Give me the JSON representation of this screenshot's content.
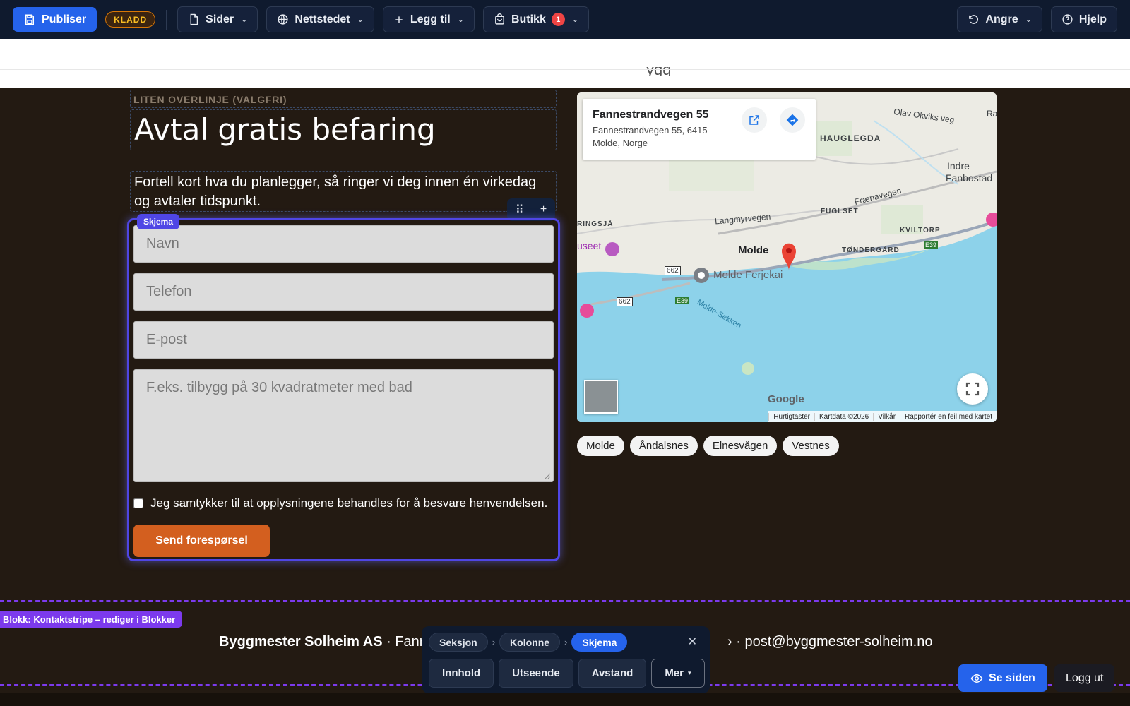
{
  "toolbar": {
    "publish_label": "Publiser",
    "draft_badge": "KLADD",
    "pages_label": "Sider",
    "site_label": "Nettstedet",
    "add_label": "Legg til",
    "shop_label": "Butikk",
    "shop_count": "1",
    "undo_label": "Angre",
    "help_label": "Hjelp"
  },
  "header_ghost": "ygg",
  "section": {
    "eyebrow": "LITEN OVERLINJE (VALGFRI)",
    "heading": "Avtal gratis befaring",
    "intro": "Fortell kort hva du planlegger, så ringer vi deg innen én virkedag og avtaler tidspunkt."
  },
  "block_tools": {
    "drag": "⠿",
    "add": "+"
  },
  "form": {
    "tag": "Skjema",
    "name_placeholder": "Navn",
    "phone_placeholder": "Telefon",
    "email_placeholder": "E-post",
    "message_placeholder": "F.eks. tilbygg på 30 kvadratmeter med bad",
    "consent_label": "Jeg samtykker til at opplysningene behandles for å besvare henvendelsen.",
    "submit_label": "Send forespørsel"
  },
  "map": {
    "place_title": "Fannestrandvegen 55",
    "place_address": "Fannestrandvegen 55, 6415 Molde, Norge",
    "labels": {
      "olav": "Olav Okviks veg",
      "haugl": "HAUGLEGDA",
      "indre": "Indre",
      "fanbostad": "Fanbostad",
      "fraen": "Frænavegen",
      "fuglset": "FUGLSET",
      "kviltorp": "KVILTORP",
      "langmyr": "Langmyrvegen",
      "ringsja": "RINGSJÅ",
      "useet": "useet",
      "molde": "Molde",
      "tonder": "TØNDERGÅRD",
      "ferjekai": "Molde Ferjekai",
      "sekken": "Molde-Sekken",
      "r662a": "662",
      "r662b": "662",
      "e39a": "E39",
      "e39b": "E39",
      "ra": "Ra"
    },
    "google": "Google",
    "attribution": [
      "Hurtigtaster",
      "Kartdata ©2026",
      "Vilkår",
      "Rapportér en feil med kartet"
    ]
  },
  "chips": [
    "Molde",
    "Åndalsnes",
    "Elnesvågen",
    "Vestnes"
  ],
  "footer": {
    "block_label": "Blokk: Kontaktstripe – rediger i Blokker",
    "company": "Byggmester Solheim AS",
    "address_part": " · Fanne",
    "email_part": "› · post@byggmester-solheim.no"
  },
  "inspector": {
    "crumbs": [
      "Seksjon",
      "Kolonne",
      "Skjema"
    ],
    "tabs": [
      "Innhold",
      "Utseende",
      "Avstand",
      "Mer"
    ]
  },
  "view_site_label": "Se siden",
  "logout_label": "Logg ut",
  "colors": {
    "accent": "#2563eb",
    "selection": "#4f46e5",
    "block": "#7c3aed",
    "cta": "#d35f1f",
    "bg": "#231a12"
  }
}
